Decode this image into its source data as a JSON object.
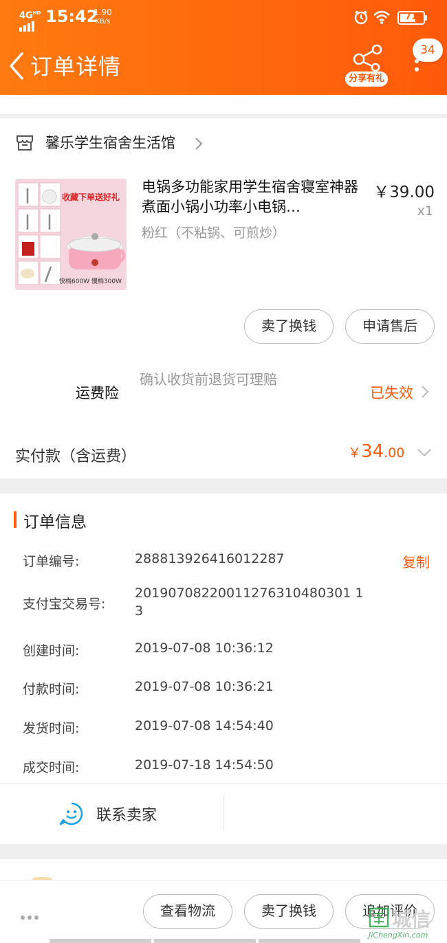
{
  "status_bar": {
    "network": "4G",
    "network_sub": "HD",
    "time": "15:42",
    "speed_value": "1.90",
    "speed_unit": "KB/s",
    "battery": "71"
  },
  "nav": {
    "title": "订单详情",
    "share_label": "分享有礼",
    "message_count": "34"
  },
  "shop": {
    "name": "馨乐学生宿舍生活馆"
  },
  "product": {
    "title": "电锅多功能家用学生宿舍寝室神器煮面小锅小功率小电锅…",
    "sku": "粉红（不粘锅、可煎炒）",
    "price": "￥39.00",
    "quantity": "x1",
    "image_text_banner": "收藏下单送好礼",
    "image_text_power": "快档600W  慢档300W"
  },
  "item_actions": {
    "sell_exchange": "卖了换钱",
    "after_sale": "申请售后"
  },
  "insurance": {
    "label": "运费险",
    "description": "确认收货前退货可理赔",
    "status": "已失效"
  },
  "payment": {
    "label": "实付款（含运费）",
    "currency": "￥",
    "amount_int": "34",
    "amount_dec": ".00"
  },
  "order_info": {
    "section_title": "订单信息",
    "copy_label": "复制",
    "rows": [
      {
        "label": "订单编号:",
        "value": "288813926416012287"
      },
      {
        "label": "支付宝交易号:",
        "value": "20190708220011276310480301 13"
      },
      {
        "label": "创建时间:",
        "value": "2019-07-08 10:36:12"
      },
      {
        "label": "付款时间:",
        "value": "2019-07-08 10:36:21"
      },
      {
        "label": "发货时间:",
        "value": "2019-07-08 14:54:40"
      },
      {
        "label": "成交时间:",
        "value": "2019-07-18 14:54:50"
      }
    ],
    "contact_label": "联系卖家"
  },
  "bottom_bar": {
    "logistics": "查看物流",
    "sell_exchange": "卖了换钱",
    "add_review": "追加评价"
  },
  "watermark": {
    "text_cn": "城信",
    "text_en": "JiChengXin.com"
  },
  "colors": {
    "accent": "#ff5a0a",
    "header_start": "#ff7a10",
    "header_end": "#ff5a0a"
  }
}
